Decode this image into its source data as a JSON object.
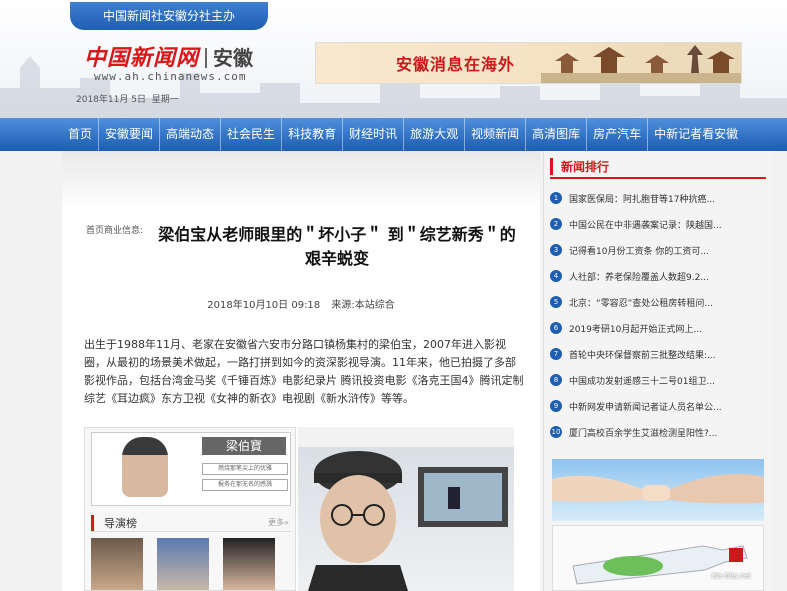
{
  "header": {
    "host_org": "中国新闻社安徽分社主办",
    "logo_cn": "中国新闻网",
    "logo_region": "安徽",
    "logo_url": "www.ah.chinanews.com",
    "date": "2018年11月 5日",
    "weekday": "星期一",
    "banner_text": "安徽消息在海外"
  },
  "nav": {
    "items": [
      "首页",
      "安徽要闻",
      "高端动态",
      "社会民生",
      "科技教育",
      "财经时讯",
      "旅游大观",
      "视频新闻",
      "高清图库",
      "房产汽车",
      "中新记者看安徽"
    ]
  },
  "article": {
    "breadcrumb": "首页商业信息:",
    "headline": "梁伯宝从老师眼里的＂坏小子＂ 到＂综艺新秀＂的艰辛蜕变",
    "datetime": "2018年10月10日 09:18",
    "source": "来源:本站综合",
    "body": "出生于1988年11月、老家在安徽省六安市分路口镇杨集村的梁伯宝，2007年进入影视圈，从最初的场景美术做起，一路打拼到如今的资深影视导演。11年来，他已拍摄了多部影视作品，包括台湾金马奖《千锤百炼》电影纪录片 腾讯投资电影《洛克王国4》腾讯定制综艺《耳边疯》东方卫视《女神的新衣》电视剧《新水浒传》等等。",
    "photo_left": {
      "name_card": "梁伯寶",
      "line1": "燃烧那笔尖上的优雅",
      "line2": "报务在那无名的感溅",
      "section_title": "导演榜",
      "more": "更多»"
    }
  },
  "sidebar": {
    "title": "新闻排行",
    "ranks": [
      {
        "num": "1",
        "text": "国家医保局：阿扎胞苷等17种抗癌..."
      },
      {
        "num": "2",
        "text": "中国公民在中非遇袭案记录：陕越国..."
      },
      {
        "num": "3",
        "text": "记得看10月份工资条 你的工资可..."
      },
      {
        "num": "4",
        "text": "人社部：养老保险覆盖人数超9.2..."
      },
      {
        "num": "5",
        "text": "北京：“零容忍”查处公租房转租问..."
      },
      {
        "num": "6",
        "text": "2019考研10月起开始正式网上..."
      },
      {
        "num": "7",
        "text": "首轮中央环保督察前三批整改结果:..."
      },
      {
        "num": "8",
        "text": "中国成功发射遥感三十二号01组卫..."
      },
      {
        "num": "9",
        "text": "中新网发申请新闻记者证人员名单公..."
      },
      {
        "num": "10",
        "text": "厦门高校百余学生艾滋检测呈阳性?..."
      }
    ],
    "watermark": "ida-bbs.net"
  },
  "colors": {
    "brand_red": "#d71718",
    "nav_blue": "#1d5db2"
  }
}
